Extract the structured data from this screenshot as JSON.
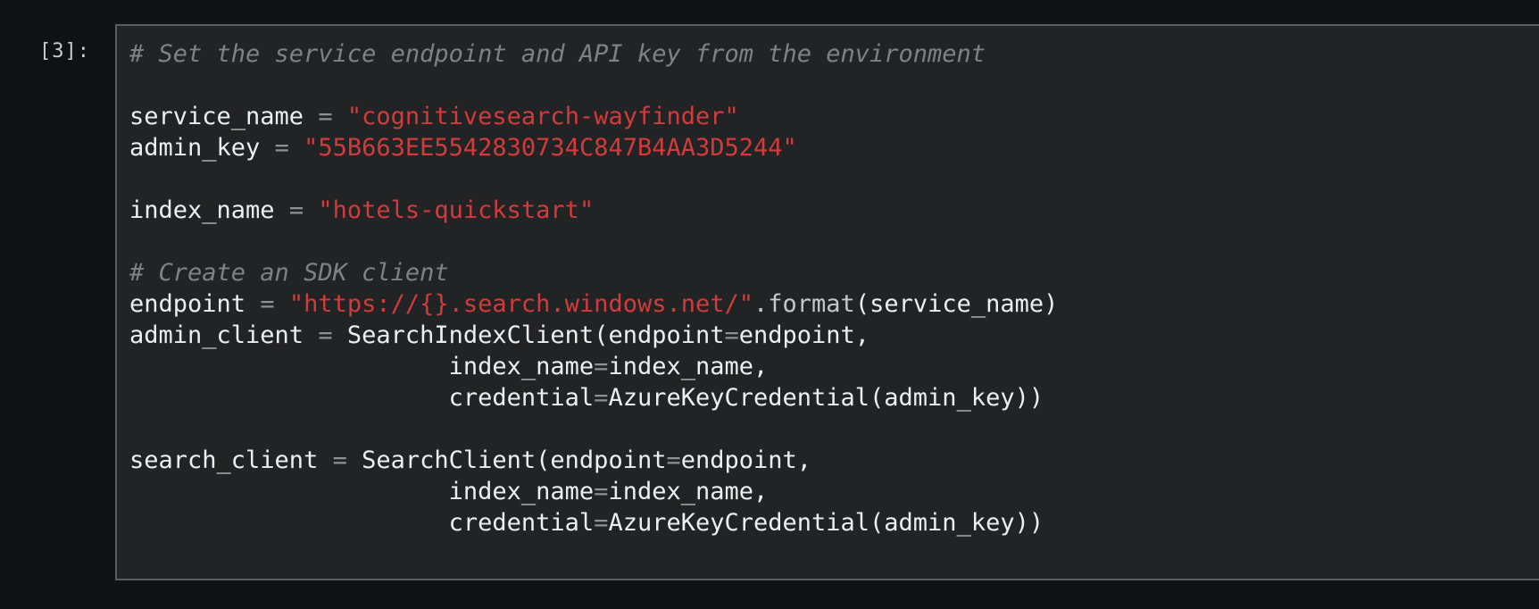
{
  "cell": {
    "prompt": "[3]:",
    "lines": [
      [
        {
          "t": "# Set the service endpoint and API key from the environment",
          "c": "cm"
        }
      ],
      [],
      [
        {
          "t": "service_name "
        },
        {
          "t": "=",
          "c": "op"
        },
        {
          "t": " "
        },
        {
          "t": "\"cognitivesearch-wayfinder\"",
          "c": "st"
        }
      ],
      [
        {
          "t": "admin_key "
        },
        {
          "t": "=",
          "c": "op"
        },
        {
          "t": " "
        },
        {
          "t": "\"55B663EE5542830734C847B4AA3D5244\"",
          "c": "st"
        }
      ],
      [],
      [
        {
          "t": "index_name "
        },
        {
          "t": "=",
          "c": "op"
        },
        {
          "t": " "
        },
        {
          "t": "\"hotels-quickstart\"",
          "c": "st"
        }
      ],
      [],
      [
        {
          "t": "# Create an SDK client",
          "c": "cm"
        }
      ],
      [
        {
          "t": "endpoint "
        },
        {
          "t": "=",
          "c": "op"
        },
        {
          "t": " "
        },
        {
          "t": "\"https://{}.search.windows.net/\"",
          "c": "st"
        },
        {
          "t": ".format",
          "c": "fn"
        },
        {
          "t": "(service_name)"
        }
      ],
      [
        {
          "t": "admin_client "
        },
        {
          "t": "=",
          "c": "op"
        },
        {
          "t": " SearchIndexClient(endpoint"
        },
        {
          "t": "=",
          "c": "op"
        },
        {
          "t": "endpoint,"
        }
      ],
      [
        {
          "t": "                      index_name"
        },
        {
          "t": "=",
          "c": "op"
        },
        {
          "t": "index_name,"
        }
      ],
      [
        {
          "t": "                      credential"
        },
        {
          "t": "=",
          "c": "op"
        },
        {
          "t": "AzureKeyCredential(admin_key))"
        }
      ],
      [],
      [
        {
          "t": "search_client "
        },
        {
          "t": "=",
          "c": "op"
        },
        {
          "t": " SearchClient(endpoint"
        },
        {
          "t": "=",
          "c": "op"
        },
        {
          "t": "endpoint,"
        }
      ],
      [
        {
          "t": "                      index_name"
        },
        {
          "t": "=",
          "c": "op"
        },
        {
          "t": "index_name,"
        }
      ],
      [
        {
          "t": "                      credential"
        },
        {
          "t": "=",
          "c": "op"
        },
        {
          "t": "AzureKeyCredential(admin_key))"
        }
      ]
    ]
  },
  "colors": {
    "background": "#0f1112",
    "editor_background": "#222324",
    "comment": "#7a8389",
    "string": "#d23b3b",
    "text": "#eceff1"
  }
}
